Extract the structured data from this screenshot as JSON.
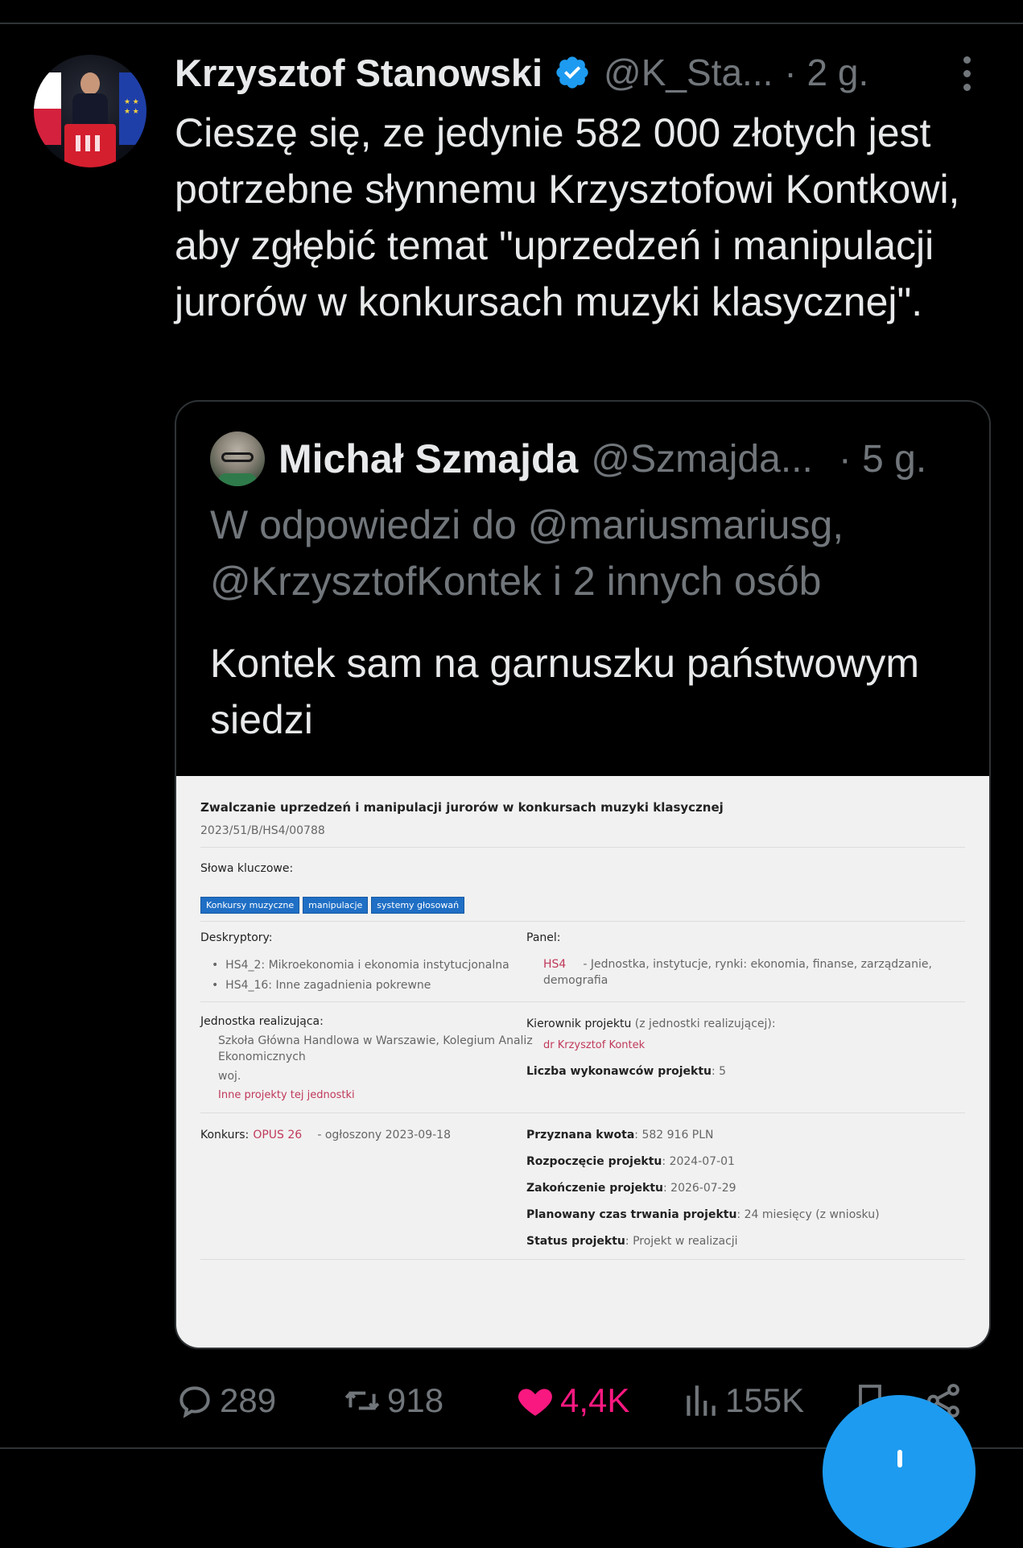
{
  "tweet": {
    "author_name": "Krzysztof Stanowski",
    "handle": "@K_Sta...",
    "time": "· 2 g.",
    "text": "Cieszę się, ze jedynie 582 000 złotych jest potrzebne słynnemu Krzysztofowi Kontkowi, aby zgłębić temat \"uprzedzeń i manipulacji jurorów w konkursach muzyki klasycznej\"."
  },
  "quote": {
    "author_name": "Michał Szmajda",
    "handle": "@Szmajda...",
    "time": "· 5 g.",
    "reply_to": "W odpowiedzi do @mariusmariusg, @KrzysztofKontek i 2 innych osób",
    "text": "Kontek sam na garnuszku państwowym siedzi",
    "document": {
      "title": "Zwalczanie uprzedzeń i manipulacji jurorów w konkursach muzyki klasycznej",
      "code": "2023/51/B/HS4/00788",
      "keywords_label": "Słowa kluczowe:",
      "keywords": [
        "Konkursy muzyczne",
        "manipulacje",
        "systemy głosowań"
      ],
      "descriptors_label": "Deskryptory:",
      "descriptors": [
        "HS4_2: Mikroekonomia i ekonomia instytucjonalna",
        "HS4_16: Inne zagadnienia pokrewne"
      ],
      "panel_label": "Panel:",
      "panel_code": "HS4",
      "panel_text_1": "- Jednostka, instytucje, rynki: ekonomia, finanse, zarządzanie,",
      "panel_text_2": "demografia",
      "unit_label": "Jednostka realizująca:",
      "unit_line_1": "Szkoła Główna Handlowa w Warszawie, Kolegium Analiz",
      "unit_line_2": "Ekonomicznych",
      "unit_line_3": "woj.",
      "unit_link": "Inne projekty tej jednostki",
      "manager_label": "Kierownik projektu",
      "manager_suffix": " (z jednostki realizującej):",
      "manager_name": "dr Krzysztof Kontek",
      "contractors_label": "Liczba wykonawców projektu",
      "contractors_value": ": 5",
      "contest_label": "Konkurs:",
      "contest_name": "OPUS 26",
      "contest_date": "- ogłoszony 2023-09-18",
      "amount_label": "Przyznana kwota",
      "amount_value": ": 582 916 PLN",
      "start_label": "Rozpoczęcie projektu",
      "start_value": ": 2024-07-01",
      "end_label": "Zakończenie projektu",
      "end_value": ": 2026-07-29",
      "duration_label": "Planowany czas trwania projektu",
      "duration_value": ": 24 miesięcy (z wniosku)",
      "status_label": "Status projektu",
      "status_value": ": Projekt w realizacji"
    }
  },
  "actions": {
    "replies": "289",
    "retweets": "918",
    "likes": "4,4K",
    "views": "155K"
  },
  "colors": {
    "accent": "#1d9bf0",
    "like": "#f91880",
    "muted": "#71767b"
  },
  "icons": [
    "more-icon",
    "verified-icon",
    "reply-icon",
    "retweet-icon",
    "like-icon",
    "views-icon",
    "bookmark-icon",
    "share-icon",
    "compose-icon"
  ]
}
